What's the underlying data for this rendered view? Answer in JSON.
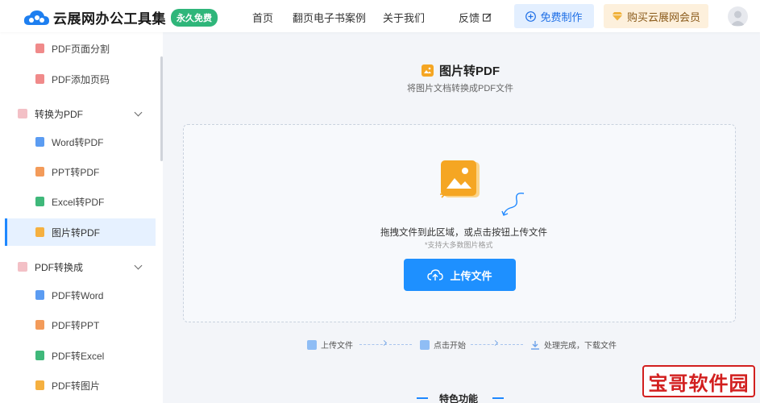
{
  "header": {
    "logo_text": "云展网办公工具集",
    "badge": "永久免费",
    "nav": [
      "首页",
      "翻页电子书案例",
      "关于我们"
    ],
    "feedback": "反馈",
    "free_btn": "免费制作",
    "vip_btn": "购买云展网会员"
  },
  "sidebar": {
    "items_top": [
      "PDF页面分割",
      "PDF添加页码"
    ],
    "group1": "转换为PDF",
    "group1_items": [
      "Word转PDF",
      "PPT转PDF",
      "Excel转PDF",
      "图片转PDF"
    ],
    "group2": "PDF转换成",
    "group2_items": [
      "PDF转Word",
      "PDF转PPT",
      "PDF转Excel",
      "PDF转图片"
    ]
  },
  "main": {
    "title": "图片转PDF",
    "subtitle": "将图片文档转换成PDF文件",
    "drop_text": "拖拽文件到此区域，或点击按钮上传文件",
    "drop_hint": "*支持大多数图片格式",
    "upload_btn": "上传文件",
    "steps": [
      "上传文件",
      "点击开始",
      "处理完成，下载文件"
    ],
    "features": "特色功能"
  },
  "watermark": "宝哥软件园",
  "colors": {
    "accent": "#1e90ff",
    "badge": "#2fb67a",
    "icon_orange": "#f5a623",
    "watermark": "#d21f1f"
  }
}
